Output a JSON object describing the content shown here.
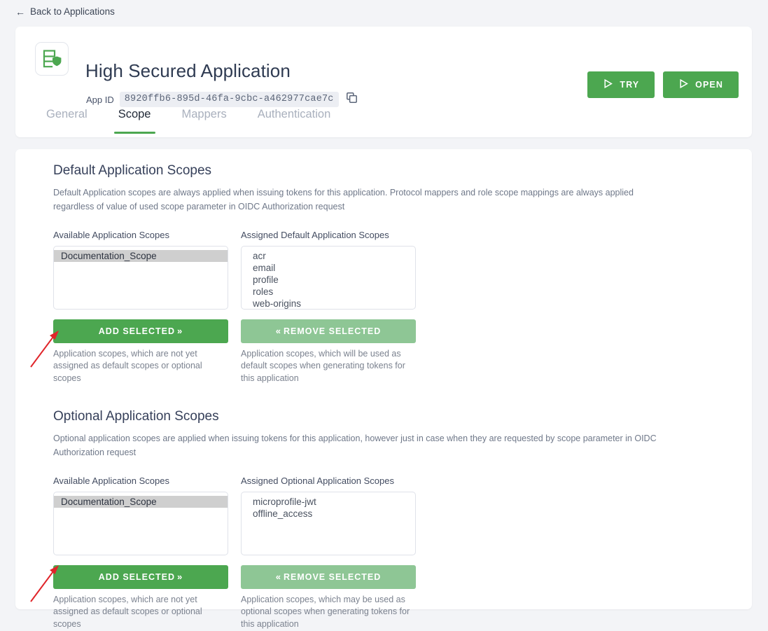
{
  "nav": {
    "back_label": "Back to Applications",
    "back_icon": "arrow-left-icon"
  },
  "header": {
    "app_icon": "secured-application-icon",
    "title": "High Secured Application",
    "app_id_label": "App ID",
    "app_id_value": "8920ffb6-895d-46fa-9cbc-a462977cae7c",
    "copy_icon": "copy-icon",
    "buttons": [
      {
        "label": "TRY",
        "icon": "play-icon",
        "color": "#4CA750"
      },
      {
        "label": "OPEN",
        "icon": "play-icon",
        "color": "#4CA750"
      }
    ]
  },
  "tabs": [
    {
      "label": "General",
      "active": false
    },
    {
      "label": "Scope",
      "active": true
    },
    {
      "label": "Mappers",
      "active": false
    },
    {
      "label": "Authentication",
      "active": false
    }
  ],
  "colors": {
    "accent_green": "#4CA750",
    "accent_green_light": "#8EC695",
    "page_bg": "#f3f4f7",
    "card_bg": "#ffffff",
    "annotation_red": "#e0252a"
  },
  "sections": [
    {
      "title": "Default Application Scopes",
      "description": "Default Application scopes are always applied when issuing tokens for this application. Protocol mappers and role scope mappings are always applied regardless of value of used scope parameter in OIDC Authorization request",
      "available": {
        "label": "Available Application Scopes",
        "items": [
          "Documentation_Scope"
        ],
        "selected": "Documentation_Scope",
        "button_label": "ADD SELECTED",
        "button_chevron": "»",
        "helper": "Application scopes, which are not yet assigned as default scopes or optional scopes"
      },
      "assigned": {
        "label": "Assigned Default Application Scopes",
        "items": [
          "acr",
          "email",
          "profile",
          "roles",
          "web-origins"
        ],
        "button_label": "REMOVE SELECTED",
        "button_chevron": "«",
        "helper": "Application scopes, which will be used as default scopes when generating tokens for this application"
      }
    },
    {
      "title": "Optional Application Scopes",
      "description": "Optional application scopes are applied when issuing tokens for this application, however just in case when they are requested by scope parameter in OIDC Authorization request",
      "available": {
        "label": "Available Application Scopes",
        "items": [
          "Documentation_Scope"
        ],
        "selected": "Documentation_Scope",
        "button_label": "ADD SELECTED",
        "button_chevron": "»",
        "helper": "Application scopes, which are not yet assigned as default scopes or optional scopes"
      },
      "assigned": {
        "label": "Assigned Optional Application Scopes",
        "items": [
          "microprofile-jwt",
          "offline_access"
        ],
        "button_label": "REMOVE SELECTED",
        "button_chevron": "«",
        "helper": "Application scopes, which may be used as optional scopes when generating tokens for this application"
      }
    }
  ],
  "annotations": [
    {
      "name": "arrow-to-add-selected-default",
      "target": "ADD SELECTED"
    },
    {
      "name": "arrow-to-add-selected-optional",
      "target": "ADD SELECTED"
    }
  ]
}
